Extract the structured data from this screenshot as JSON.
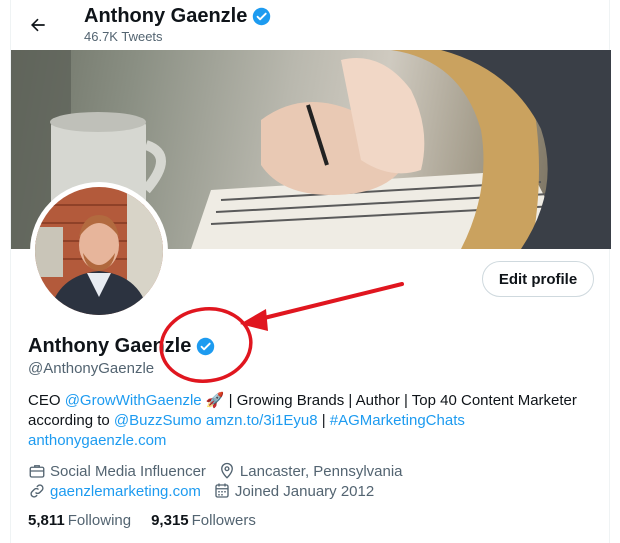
{
  "header": {
    "name": "Anthony Gaenzle",
    "tweet_count": "46.7K Tweets"
  },
  "profile": {
    "name": "Anthony Gaenzle",
    "handle": "@AnthonyGaenzle",
    "edit_label": "Edit profile",
    "bio": {
      "p1": "CEO ",
      "link1": "@GrowWithGaenzle",
      "p2": " 🚀 | Growing Brands | Author | Top 40 Content Marketer according to ",
      "link2": "@BuzzSumo",
      "p3": " ",
      "link3": "amzn.to/3i1Eyu8",
      "p4": " | ",
      "link4": "#AGMarketingChats",
      "link5": "anthonygaenzle.com"
    },
    "category": "Social Media Influencer",
    "location": "Lancaster, Pennsylvania",
    "website": "gaenzlemarketing.com",
    "joined": "Joined January 2012",
    "following_count": "5,811",
    "following_label": "Following",
    "followers_count": "9,315",
    "followers_label": "Followers"
  },
  "colors": {
    "accent": "#1d9bf0",
    "annotation": "#e0161f"
  },
  "icons": [
    "back-arrow-icon",
    "verified-badge-icon",
    "briefcase-icon",
    "location-pin-icon",
    "link-icon",
    "calendar-icon"
  ]
}
